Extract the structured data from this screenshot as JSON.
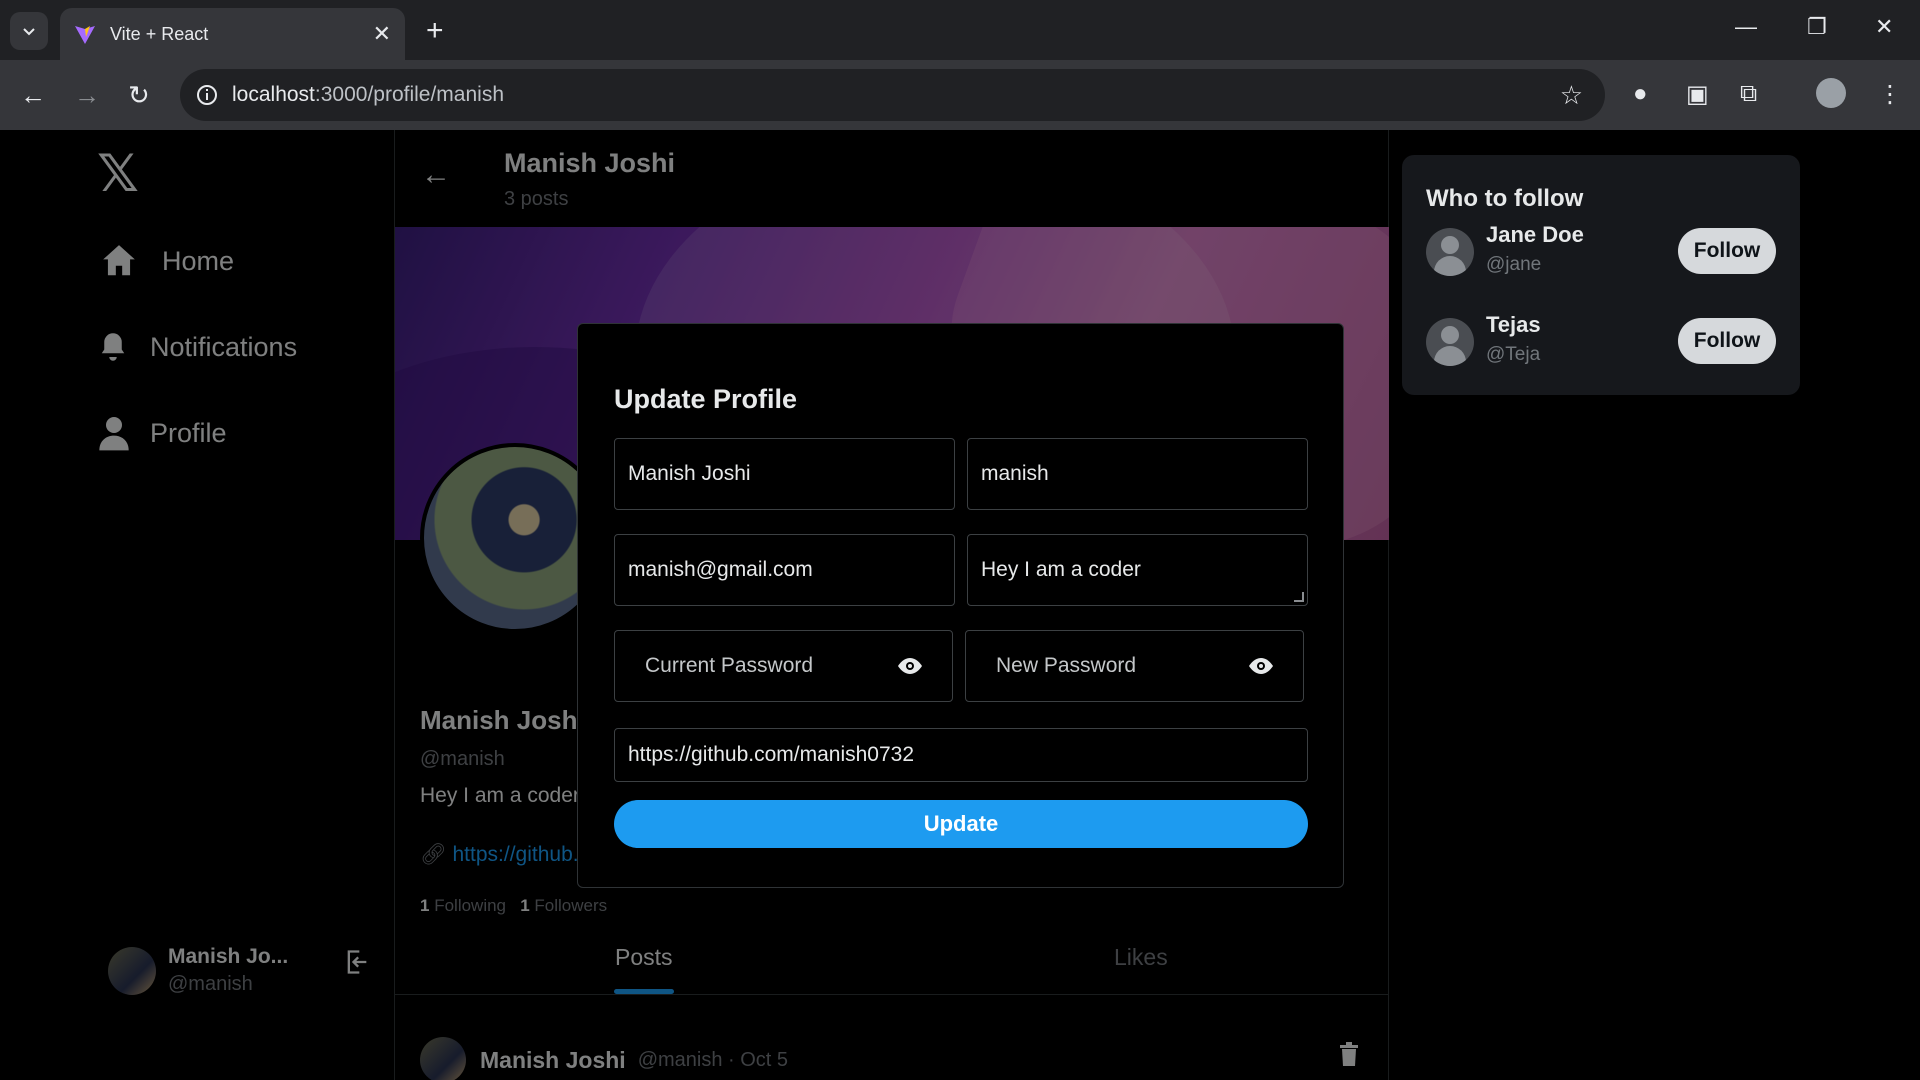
{
  "browser": {
    "tab_title": "Vite + React",
    "url_host": "localhost",
    "url_rest": ":3000/profile/manish"
  },
  "sidebar": {
    "logo": "𝕏",
    "items": [
      {
        "label": "Home"
      },
      {
        "label": "Notifications"
      },
      {
        "label": "Profile"
      }
    ],
    "me": {
      "name": "Manish Jo...",
      "handle": "@manish"
    }
  },
  "profile": {
    "header_name": "Manish Joshi",
    "post_count": "3 posts",
    "name": "Manish Josh",
    "handle": "@manish",
    "bio": "Hey I am a coder",
    "link": "https://github.",
    "following_count": "1",
    "following_label": "Following",
    "followers_count": "1",
    "followers_label": "Followers",
    "tabs": {
      "posts": "Posts",
      "likes": "Likes"
    },
    "post": {
      "name": "Manish Joshi",
      "meta": "@manish · Oct 5"
    }
  },
  "who_to_follow": {
    "title": "Who to follow",
    "users": [
      {
        "name": "Jane Doe",
        "handle": "@jane",
        "button": "Follow"
      },
      {
        "name": "Tejas",
        "handle": "@Teja",
        "button": "Follow"
      }
    ]
  },
  "modal": {
    "title": "Update Profile",
    "full_name": "Manish Joshi",
    "username": "manish",
    "email": "manish@gmail.com",
    "bio": "Hey I am a coder",
    "current_password_placeholder": "Current Password",
    "new_password_placeholder": "New Password",
    "link": "https://github.com/manish0732",
    "update_label": "Update"
  },
  "colors": {
    "accent": "#1d9bf0",
    "background": "#000000",
    "muted": "#71767b"
  }
}
